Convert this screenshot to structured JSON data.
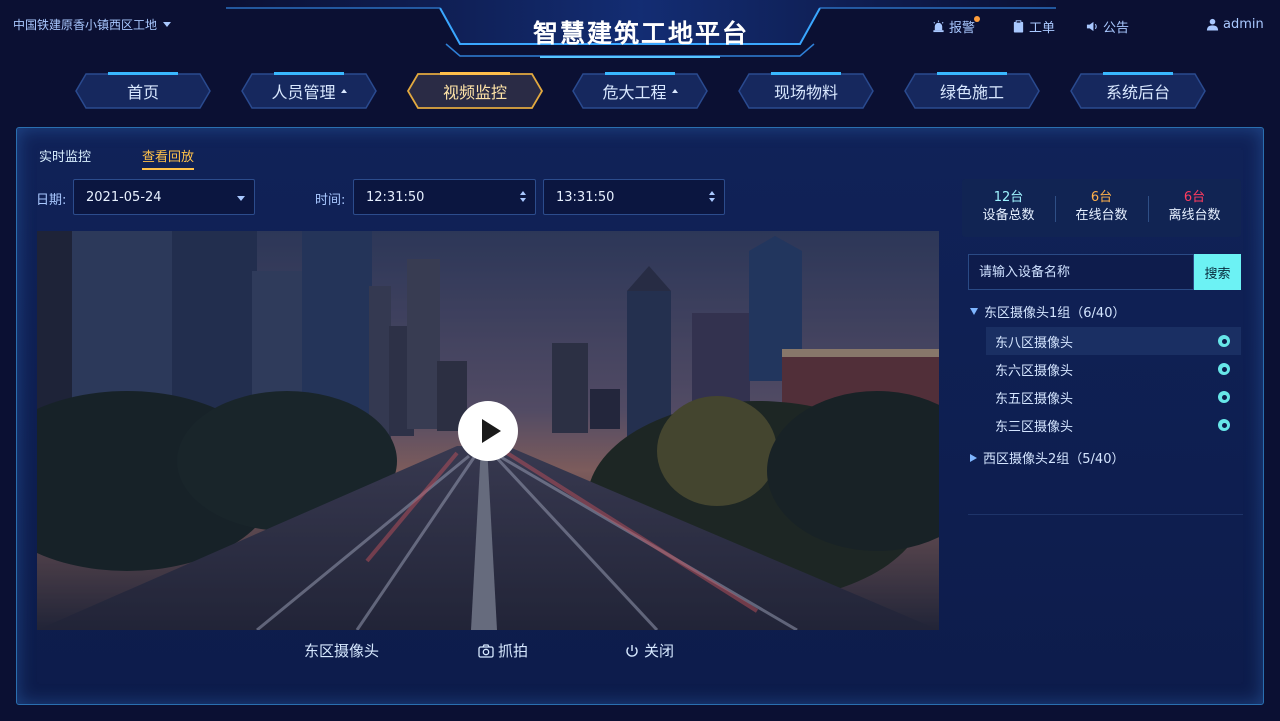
{
  "header": {
    "project": "中国铁建原香小镇西区工地",
    "title": "智慧建筑工地平台",
    "actions": {
      "alarm": "报警",
      "workorder": "工单",
      "notice": "公告",
      "user": "admin"
    }
  },
  "nav": {
    "items": [
      {
        "label": "首页",
        "dropdown": false
      },
      {
        "label": "人员管理",
        "dropdown": true
      },
      {
        "label": "视频监控",
        "dropdown": false,
        "active": true
      },
      {
        "label": "危大工程",
        "dropdown": true
      },
      {
        "label": "现场物料",
        "dropdown": false
      },
      {
        "label": "绿色施工",
        "dropdown": false
      },
      {
        "label": "系统后台",
        "dropdown": false
      }
    ]
  },
  "tabs": {
    "live": "实时监控",
    "playback": "查看回放"
  },
  "filters": {
    "date_label": "日期:",
    "date_value": "2021-05-24",
    "time_label": "时间:",
    "time_start": "12:31:50",
    "time_end": "13:31:50"
  },
  "video": {
    "camera_name": "东区摄像头",
    "capture": "抓拍",
    "close": "关闭"
  },
  "stats": [
    {
      "value": "12台",
      "label": "设备总数",
      "color": "#9ff4ff"
    },
    {
      "value": "6台",
      "label": "在线台数",
      "color": "#ffb04a"
    },
    {
      "value": "6台",
      "label": "离线台数",
      "color": "#ff3c5f"
    }
  ],
  "search": {
    "placeholder": "请输入设备名称",
    "button": "搜索"
  },
  "tree": {
    "group1": "东区摄像头1组（6/40）",
    "cameras": [
      "东八区摄像头",
      "东六区摄像头",
      "东五区摄像头",
      "东三区摄像头"
    ],
    "group2": "西区摄像头2组（5/40）"
  },
  "colors": {
    "accent_cyan": "#6cf2f4",
    "active_tab": "#ffc24a",
    "background": "#0b1033"
  }
}
